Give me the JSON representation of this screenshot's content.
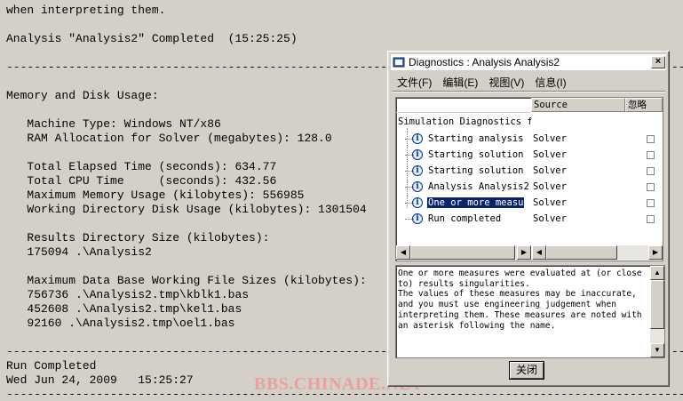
{
  "log": {
    "lines": [
      "when interpreting them.",
      "",
      "Analysis \"Analysis2\" Completed  (15:25:25)",
      "",
      "------------------------------------------------------------------------------------------------------",
      "",
      "Memory and Disk Usage:",
      "",
      "   Machine Type: Windows NT/x86",
      "   RAM Allocation for Solver (megabytes): 128.0",
      "",
      "   Total Elapsed Time (seconds): 634.77",
      "   Total CPU Time     (seconds): 432.56",
      "   Maximum Memory Usage (kilobytes): 556985",
      "   Working Directory Disk Usage (kilobytes): 1301504",
      "",
      "   Results Directory Size (kilobytes):",
      "   175094 .\\Analysis2",
      "",
      "   Maximum Data Base Working File Sizes (kilobytes):",
      "   756736 .\\Analysis2.tmp\\kblk1.bas",
      "   452608 .\\Analysis2.tmp\\kel1.bas",
      "   92160 .\\Analysis2.tmp\\oel1.bas",
      "",
      "------------------------------------------------------------------------------------------------------",
      "Run Completed",
      "Wed Jun 24, 2009   15:25:27",
      "------------------------------------------------------------------------------------------------------"
    ]
  },
  "watermark": "BBS.CHINADE.NET",
  "dialog": {
    "title": "Diagnostics : Analysis Analysis2",
    "close_label": "×",
    "menu": [
      "文件(F)",
      "编辑(E)",
      "视图(V)",
      "信息(I)"
    ],
    "columns": {
      "source": "Source",
      "ignore": "忽略"
    },
    "tree_root": "Simulation Diagnostics fo",
    "rows": [
      {
        "label": "Starting analysis",
        "source": "Solver",
        "selected": false
      },
      {
        "label": "Starting solution",
        "source": "Solver",
        "selected": false
      },
      {
        "label": "Starting solution",
        "source": "Solver",
        "selected": false
      },
      {
        "label": "Analysis Analysis2",
        "source": "Solver",
        "selected": false
      },
      {
        "label": "One or more measu",
        "source": "Solver",
        "selected": true
      },
      {
        "label": "Run completed",
        "source": "Solver",
        "selected": false
      }
    ],
    "message": "One or more measures were evaluated at (or close to) results singularities.\nThe values of these measures may be inaccurate, and you must use engineering judgement when interpreting them. These measures are noted with an asterisk following the name.",
    "ok_label": "关闭",
    "colors": {
      "selection": "#0a246a",
      "info_icon": "#003399",
      "watermark": "#e8a0a0"
    }
  }
}
